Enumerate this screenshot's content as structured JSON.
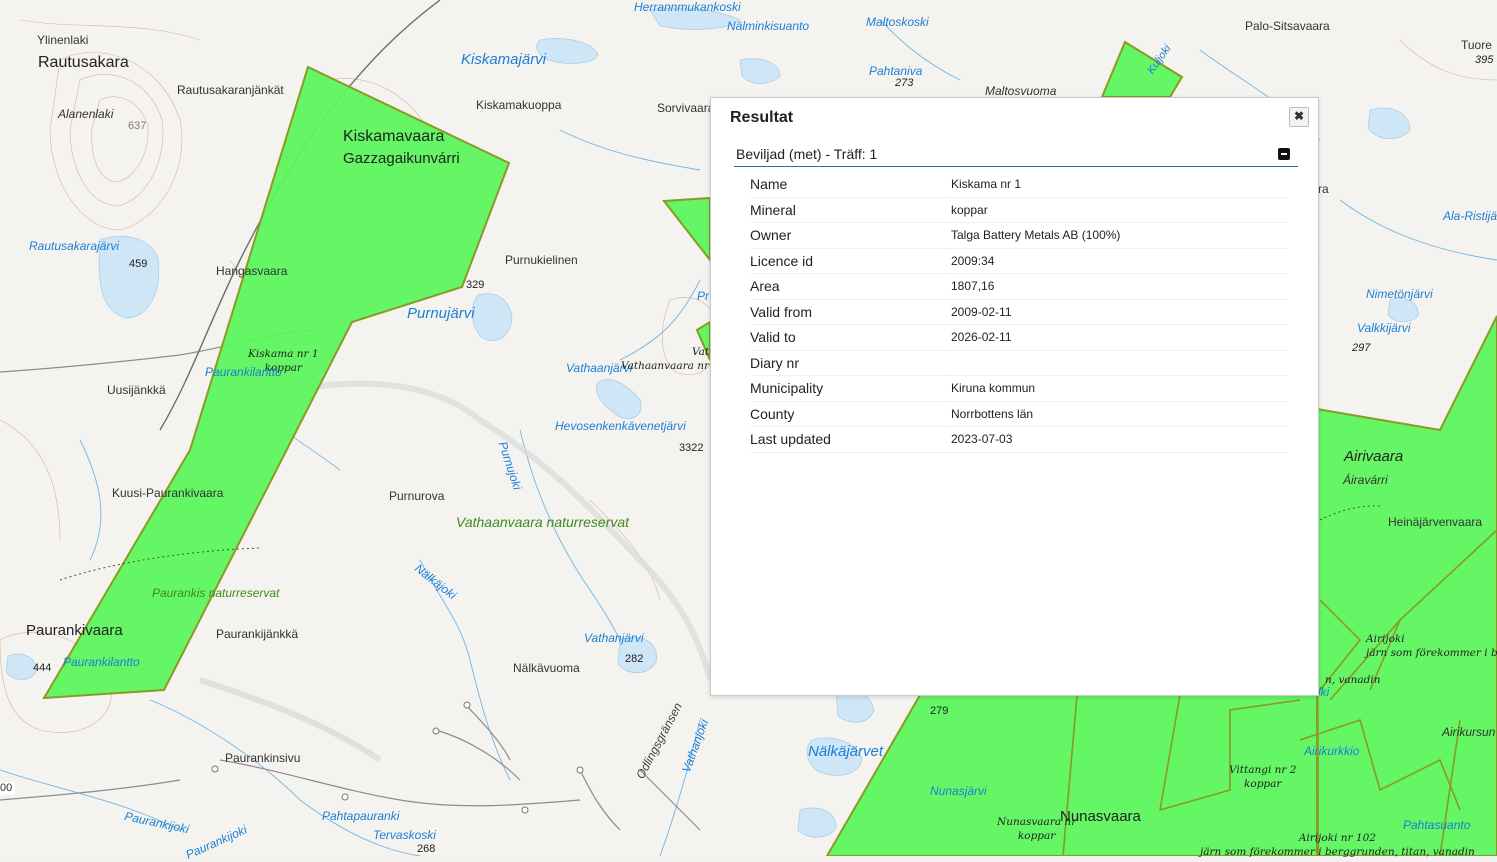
{
  "map": {
    "labels": {
      "ylinenlaki": "Ylinenlaki",
      "rautusakara": "Rautusakara",
      "rautusakaranjankat": "Rautusakaranjänkät",
      "alanenlaki": "Alanenlaki",
      "elev_637": "637",
      "kiskamavaara": "Kiskamavaara",
      "gazzagaikunvarri": "Gazzagaikunvárri",
      "rautusakarajarvi": "Rautusakarajärvi",
      "elev_459": "459",
      "hangasvaara": "Hangasvaara",
      "purnukielinen": "Purnukielinen",
      "elev_329": "329",
      "purnujarvi": "Purnujärvi",
      "kiskama_licence": "Kiskama nr 1\nkoppar",
      "paurankilantto_n": "Paurankilantto",
      "uusijankka": "Uusijänkkä",
      "vathaanjarvi": "Vathaanjärvi",
      "hevosenkenkavenetjarvi": "Hevosenkenkävenetjärvi",
      "elev_332": "3322",
      "purnujoki": "Purnujoki",
      "kuusi_paurankivaara": "Kuusi-Paurankivaara",
      "purnurova": "Purnurova",
      "vathaanvaara_reserve": "Vathaanvaara naturreservat",
      "paurankis_reserve": "Paurankis naturreservat",
      "nalkajoki": "Nälkäjoki",
      "paurankivaara": "Paurankivaara",
      "paurankijankka": "Paurankijänkkä",
      "vathanjarvi": "Vathanjärvi",
      "elev_282": "282",
      "elev_444": "444",
      "paurankilantto_s": "Paurankilantto",
      "nalkavuoma": "Nälkävuoma",
      "odlingsgransen": "Odlingsgränsen",
      "vathanjoki": "Vathanjoki",
      "paurankinsivu": "Paurankinsivu",
      "nalkajarvet": "Nälkäjärvet",
      "paurankijoki": "Paurankijoki",
      "pahtapauranki": "Pahtapauranki",
      "tervaskoski": "Tervaskoski",
      "elev_268": "268",
      "paurankijoki2": "Paurankijoki",
      "herrannmukankoski": "Herrannmukankoski",
      "nalminkisuanto": "Nälminkisuanto",
      "maltoskoski": "Maltoskoski",
      "kiskamajarvi": "Kiskamajärvi",
      "kiskamakuoppa": "Kiskamakuoppa",
      "sorvivaara": "Sorvivaara",
      "pahtaniva": "Pahtaniva",
      "elev_273": "273",
      "maltosvuoma": "Maltosvuoma",
      "palo_sitsavaara": "Palo-Sitsavaara",
      "tuore": "Tuore",
      "elev_395": "395",
      "kuljoki": "Kuljoki",
      "alaristi": "Ala-Ristijä",
      "nimetonjarvi": "Nimetönjärvi",
      "valkkijarvi": "Valkkijärvi",
      "elev_297": "297",
      "airivaara": "Airivaara",
      "airavarri": "Áiravárri",
      "heinajarvenvaara": "Heinäjärvenvaara",
      "airijoki_licence": "Airijoki\njärn som förekommer i be",
      "airikursun": "Airikursun",
      "airikurkkio": "Airikurkkio",
      "vittangi_licence": "Vittangi nr 2\nkoppar",
      "elev_279": "279",
      "nunasjarvi": "Nunasjärvi",
      "nunasvaara": "Nunasvaara",
      "nunasvaara_licence": "Nunasvaara nr\nkoppar",
      "pahtasuanto": "Pahtasuanto",
      "airijoki102": "Airijoki nr 102\njärn som förekommer i berggrunden, titan, vanadin",
      "vathaanvaara_licence": "Vathaanvaara nr\nkoppar, järn som förekommer",
      "scale_00": "00",
      "vanadin_mid": "n, vanadin",
      "lki": "lki",
      "ra": "ra",
      "pr": "Pr",
      "vat": "Vat"
    }
  },
  "popup": {
    "title": "Resultat",
    "close_label": "✖",
    "section_title": "Beviljad (met) - Träff: 1",
    "rows": [
      {
        "key": "Name",
        "value": "Kiskama nr 1"
      },
      {
        "key": "Mineral",
        "value": "koppar"
      },
      {
        "key": "Owner",
        "value": "Talga Battery Metals AB (100%)"
      },
      {
        "key": "Licence id",
        "value": "2009:34"
      },
      {
        "key": "Area",
        "value": "1807,16"
      },
      {
        "key": "Valid from",
        "value": "2009-02-11"
      },
      {
        "key": "Valid to",
        "value": "2026-02-11"
      },
      {
        "key": "Diary nr",
        "value": ""
      },
      {
        "key": "Municipality",
        "value": "Kiruna kommun"
      },
      {
        "key": "County",
        "value": "Norrbottens län"
      },
      {
        "key": "Last updated",
        "value": "2023-07-03"
      }
    ]
  },
  "colors": {
    "licence_fill": "#5cf55c",
    "licence_stroke": "#8a9a24",
    "water": "#1a7fd6",
    "reserve": "#3f8a1f"
  }
}
